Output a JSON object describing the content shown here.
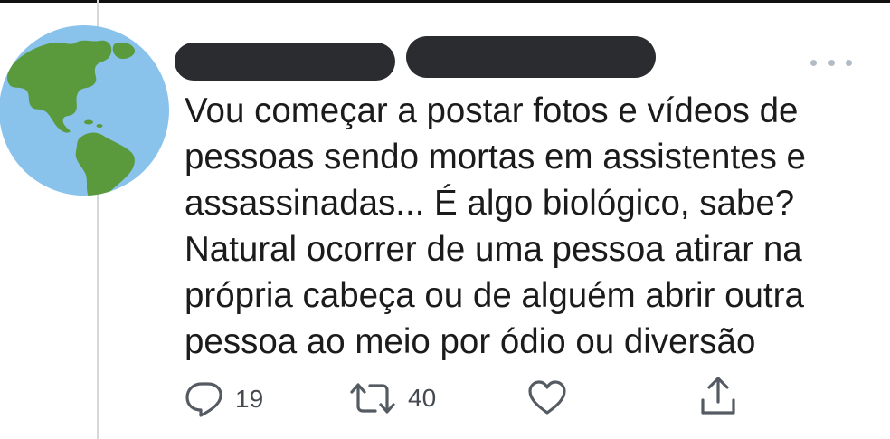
{
  "tweet": {
    "author_name_redacted": true,
    "author_handle_redacted": true,
    "text": "Vou começar a postar fotos e vídeos de\npessoas sendo mortas em assistentes e\nassassinadas... É algo biológico, sabe?\nNatural ocorrer de uma pessoa atirar na\nprópria cabeça ou de alguém abrir outra\npessoa ao meio por ódio ou diversão",
    "avatar_icon": "globe-americas-icon",
    "more_icon": "more-options-icon"
  },
  "actions": {
    "reply": {
      "icon": "reply-icon",
      "count": "19"
    },
    "retweet": {
      "icon": "retweet-icon",
      "count": "40"
    },
    "like": {
      "icon": "heart-icon",
      "count": ""
    },
    "share": {
      "icon": "share-icon"
    }
  },
  "colors": {
    "ocean": "#89c3ec",
    "land": "#5a9a3c",
    "redaction": "#2a2c30",
    "icon_gray": "#555b62",
    "thread_line": "#d6d9db"
  }
}
